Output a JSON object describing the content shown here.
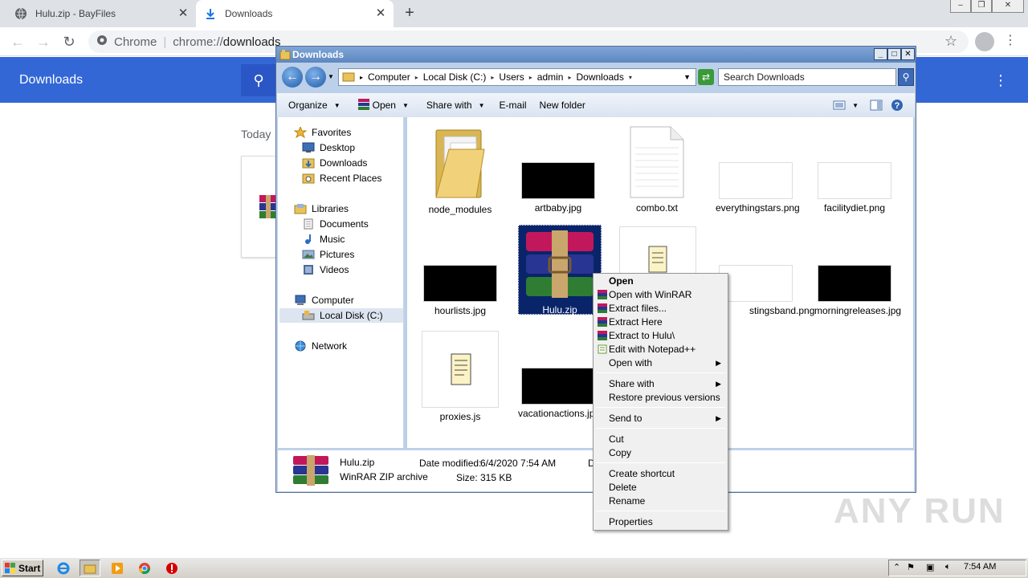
{
  "chrome": {
    "tabs": [
      {
        "title": "Hulu.zip - BayFiles",
        "active": false
      },
      {
        "title": "Downloads",
        "active": true
      }
    ],
    "new_tab": "+",
    "omnibox_site": "Chrome",
    "omnibox_url_prefix": "chrome://",
    "omnibox_url_path": "downloads",
    "downloads_title": "Downloads",
    "today_label": "Today",
    "accent": "#3367d6"
  },
  "explorer": {
    "title": "Downloads",
    "breadcrumb": [
      "Computer",
      "Local Disk (C:)",
      "Users",
      "admin",
      "Downloads"
    ],
    "search_placeholder": "Search Downloads",
    "toolbar": {
      "organize": "Organize",
      "open": "Open",
      "share_with": "Share with",
      "email": "E-mail",
      "new_folder": "New folder"
    },
    "nav": {
      "favorites": "Favorites",
      "desktop": "Desktop",
      "downloads": "Downloads",
      "recent": "Recent Places",
      "libraries": "Libraries",
      "documents": "Documents",
      "music": "Music",
      "pictures": "Pictures",
      "videos": "Videos",
      "computer": "Computer",
      "local_disk": "Local Disk (C:)",
      "network": "Network"
    },
    "files": [
      {
        "name": "node_modules",
        "kind": "folder"
      },
      {
        "name": "artbaby.jpg",
        "kind": "dark-image"
      },
      {
        "name": "combo.txt",
        "kind": "text"
      },
      {
        "name": "everythingstars.png",
        "kind": "light-image"
      },
      {
        "name": "facilitydiet.png",
        "kind": "light-image"
      },
      {
        "name": "hourlists.jpg",
        "kind": "dark-image"
      },
      {
        "name": "Hulu.zip",
        "kind": "winrar",
        "selected": true
      },
      {
        "name": "",
        "kind": "script"
      },
      {
        "name": "stingsband.png",
        "kind": "light-image"
      },
      {
        "name": "morningreleases.jpg",
        "kind": "dark-image"
      },
      {
        "name": "proxies.js",
        "kind": "script"
      },
      {
        "name": "vacationactions.jpg",
        "kind": "dark-image"
      }
    ],
    "details": {
      "name": "Hulu.zip",
      "type": "WinRAR ZIP archive",
      "modified_label": "Date modified:",
      "modified_value": "6/4/2020 7:54 AM",
      "size_label": "Size:",
      "size_value": "315 KB",
      "trailing": "D"
    }
  },
  "context_menu": {
    "open": "Open",
    "open_winrar": "Open with WinRAR",
    "extract_files": "Extract files...",
    "extract_here": "Extract Here",
    "extract_to": "Extract to Hulu\\",
    "edit_notepad": "Edit with Notepad++",
    "open_with": "Open with",
    "share_with": "Share with",
    "restore": "Restore previous versions",
    "send_to": "Send to",
    "cut": "Cut",
    "copy": "Copy",
    "create_shortcut": "Create shortcut",
    "delete": "Delete",
    "rename": "Rename",
    "properties": "Properties"
  },
  "taskbar": {
    "start": "Start",
    "clock": "7:54 AM"
  },
  "watermark": "ANY RUN"
}
